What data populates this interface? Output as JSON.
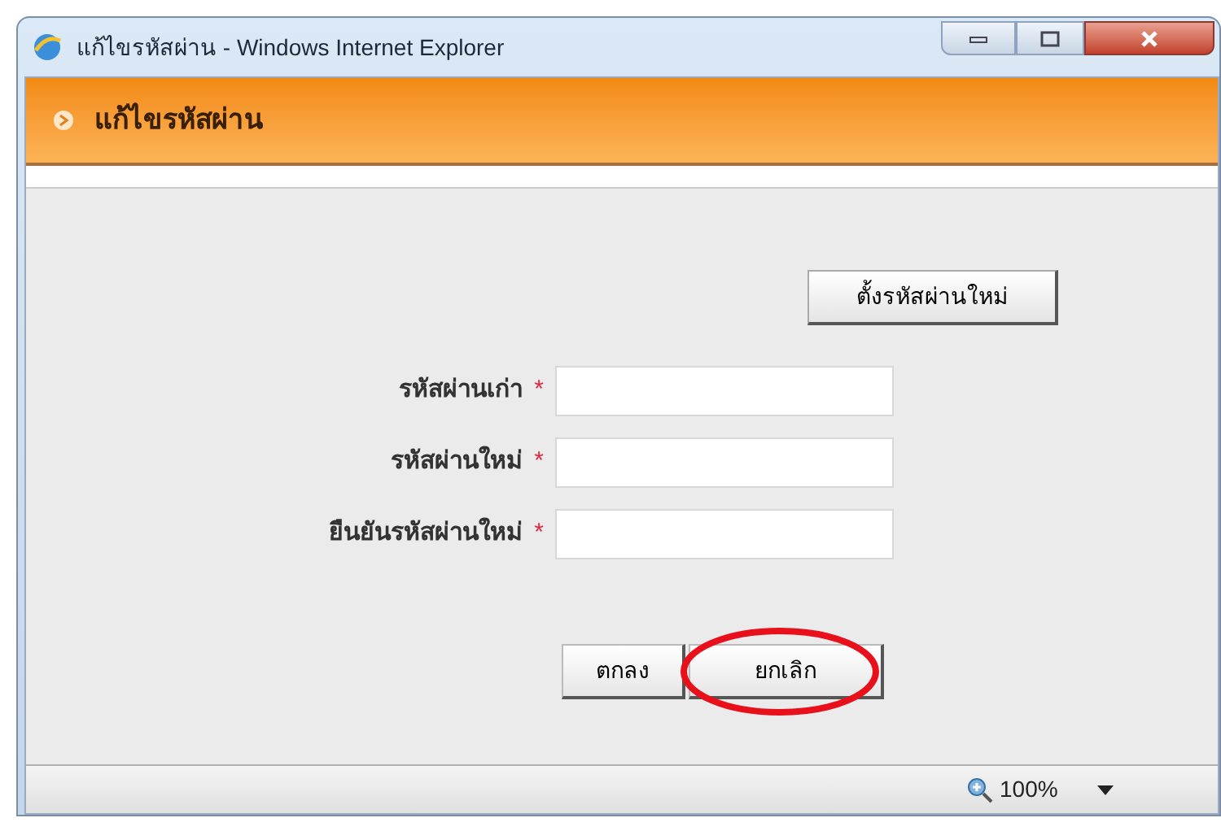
{
  "window": {
    "title": "แก้ไขรหัสผ่าน - Windows Internet Explorer"
  },
  "header": {
    "title": "แก้ไขรหัสผ่าน"
  },
  "generate_button": "ตั้งรหัสผ่านใหม่",
  "fields": [
    {
      "label": "รหัสผ่านเก่า",
      "required": true
    },
    {
      "label": "รหัสผ่านใหม่",
      "required": true
    },
    {
      "label": "ยืนยันรหัสผ่านใหม่",
      "required": true
    }
  ],
  "required_mark": "*",
  "buttons": [
    {
      "label": "ตกลง",
      "circled": false
    },
    {
      "label": "ยกเลิก",
      "circled": true
    }
  ],
  "status_bar": {
    "zoom": "100%"
  }
}
